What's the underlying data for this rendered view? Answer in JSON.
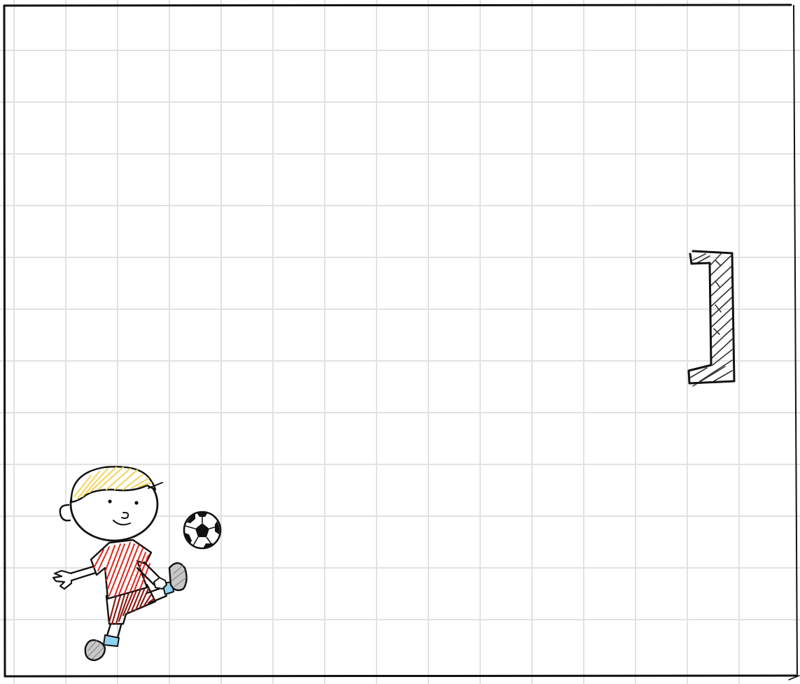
{
  "game": {
    "scene": "soccer",
    "grid": true,
    "colors": {
      "background": "#ffffff",
      "grid_line": "#e2e2e2",
      "border": "#111111",
      "ink": "#111111",
      "hair": "#f2d35a",
      "jersey": "#e0251b",
      "shorts": "#8e1b12",
      "sock_band": "#8fd3ee",
      "shoe": "#b9b9b9",
      "goal_hatch": "#222222",
      "ball_patch": "#111111"
    },
    "icons": {
      "player": "boy-kicking-player-icon",
      "ball": "soccer-ball-icon",
      "goal": "goal-net-icon"
    }
  }
}
